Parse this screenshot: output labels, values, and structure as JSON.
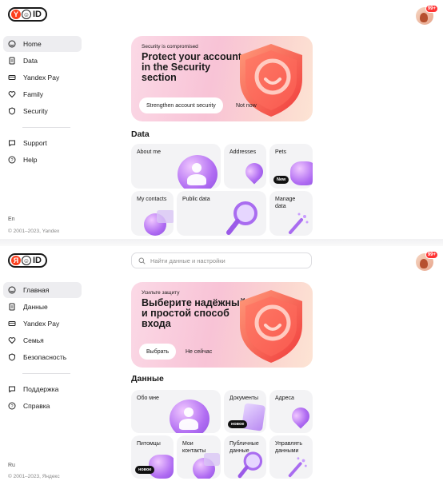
{
  "en": {
    "logo": {
      "ya": "Y",
      "id": "ID"
    },
    "avatar": {
      "badge": "99+"
    },
    "nav": {
      "items": [
        {
          "label": "Home",
          "icon": "smile-icon",
          "active": true
        },
        {
          "label": "Data",
          "icon": "document-icon",
          "active": false
        },
        {
          "label": "Yandex Pay",
          "icon": "card-icon",
          "active": false
        },
        {
          "label": "Family",
          "icon": "heart-icon",
          "active": false
        },
        {
          "label": "Security",
          "icon": "shield-icon",
          "active": false
        }
      ],
      "secondary": [
        {
          "label": "Support",
          "icon": "chat-icon"
        },
        {
          "label": "Help",
          "icon": "help-icon"
        }
      ]
    },
    "footer": {
      "lang": "En",
      "copyright": "© 2001–2023, Yandex"
    },
    "banner": {
      "kicker": "Security is compromised",
      "title": "Protect your account in the Security section",
      "primary": "Strengthen account security",
      "secondary": "Not now"
    },
    "section": "Data",
    "cards": {
      "about": "About me",
      "addresses": "Addresses",
      "pets": "Pets",
      "pets_badge": "New",
      "contacts": "My contacts",
      "public": "Public data",
      "manage": "Manage data"
    }
  },
  "ru": {
    "logo": {
      "ya": "Я",
      "id": "ID"
    },
    "avatar": {
      "badge": "99+"
    },
    "search": {
      "placeholder": "Найти данные и настройки"
    },
    "nav": {
      "items": [
        {
          "label": "Главная",
          "icon": "smile-icon",
          "active": true
        },
        {
          "label": "Данные",
          "icon": "document-icon",
          "active": false
        },
        {
          "label": "Yandex Pay",
          "icon": "card-icon",
          "active": false
        },
        {
          "label": "Семья",
          "icon": "heart-icon",
          "active": false
        },
        {
          "label": "Безопасность",
          "icon": "shield-icon",
          "active": false
        }
      ],
      "secondary": [
        {
          "label": "Поддержка",
          "icon": "chat-icon"
        },
        {
          "label": "Справка",
          "icon": "help-icon"
        }
      ]
    },
    "footer": {
      "lang": "Ru",
      "copyright": "© 2001–2023, Яндекс"
    },
    "banner": {
      "kicker": "Усильте защиту",
      "title": "Выберите надёжный и простой способ входа",
      "primary": "Выбрать",
      "secondary": "Не сейчас"
    },
    "section": "Данные",
    "cards": {
      "about": "Обо мне",
      "documents": "Документы",
      "documents_badge": "новое",
      "addresses": "Адреса",
      "pets": "Питомцы",
      "pets_badge": "новое",
      "contacts": "Мои контакты",
      "public": "Публичные данные",
      "manage": "Управлять данными"
    }
  },
  "colors": {
    "accent": "#fc3f1d",
    "badge": "#ff3333",
    "active_nav": "#ededf0",
    "card_bg": "#f3f3f5"
  }
}
